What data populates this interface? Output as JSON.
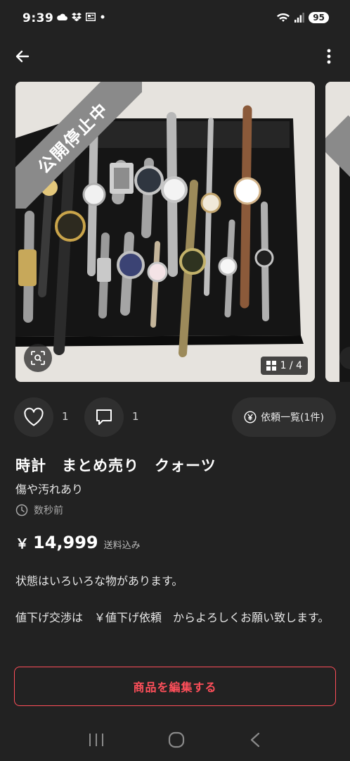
{
  "status_bar": {
    "time": "9:39",
    "battery": "95"
  },
  "gallery": {
    "status_ribbon": "公開停止中",
    "counter": "1 / 4"
  },
  "actions": {
    "like_count": "1",
    "comment_count": "1",
    "request_label": "依頼一覧(1件)"
  },
  "product": {
    "title": "時計　まとめ売り　クォーツ",
    "condition": "傷や汚れあり",
    "posted": "数秒前",
    "currency": "￥",
    "price": "14,999",
    "price_note": "送料込み",
    "description": [
      "状態はいろいろな物があります。",
      "値下げ交渉は　￥値下げ依頼　からよろしくお願い致します。"
    ]
  },
  "edit_button": {
    "label": "商品を編集する"
  },
  "colors": {
    "accent": "#ff4f5a",
    "background": "#222222",
    "surface": "#2f2f2f"
  },
  "icons": [
    "back-arrow-icon",
    "more-vertical-icon",
    "zoom-search-icon",
    "grid-icon",
    "heart-icon",
    "comment-icon",
    "yen-circle-icon",
    "clock-icon",
    "recent-apps-icon",
    "home-icon",
    "back-nav-icon"
  ]
}
